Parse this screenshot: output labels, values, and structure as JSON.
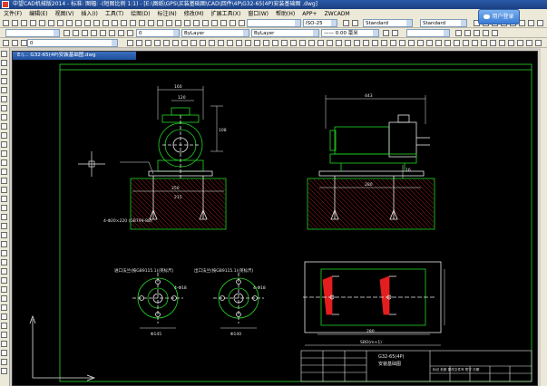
{
  "app": {
    "title": "中望CAD机械版2014 - 标准: 图幅: -(短图比例 1:1) - [E:\\图纸\\GPS\\买装基础图\\CAD\\回件\\4P\\G32-65(4P)安装基础图 .dwg]",
    "login_label": "用户登录"
  },
  "menu": [
    "文件(F)",
    "编辑(E)",
    "视图(V)",
    "插入(I)",
    "工具(T)",
    "绘图(D)",
    "标注(N)",
    "修改(M)",
    "扩展工具(X)",
    "窗口(W)",
    "帮助(H)",
    "APP+",
    "ZWCADM"
  ],
  "toolbar": {
    "text_style": "Standard",
    "dim_style": "Standard",
    "iso": "ISO-25",
    "layer": "0",
    "color": "ByLayer",
    "linetype": "ByLayer",
    "lineweight": "—— 0.00 毫米",
    "plot": "0"
  },
  "drawing": {
    "tab_title": "E:\\… G32-65(4P)安装基础图.dwg",
    "dims": {
      "front_top": "160",
      "front_h1": "120",
      "front_side": "108",
      "base_left": "250",
      "base_w": "215",
      "side_top": "443",
      "side_base": "280",
      "side_h": "16",
      "plan_w": "280",
      "plan_total": "SBO(m+1)"
    },
    "labels": {
      "anchor": "4-Φ20×220\n(GB799-88)",
      "circle_left": "进口法兰(按GB9115.1)(英标尺)",
      "circle_right": "出口法兰(按GB9115.1)(英标尺)",
      "dn_left": "Φ145",
      "dn_right": "Φ140",
      "holes": "4-Φ18"
    },
    "titleblock": {
      "name": "G32-65(4P)",
      "subtitle": "安装基础图",
      "cols": [
        "标记",
        "处数",
        "更改文件号",
        "签字",
        "日期"
      ]
    }
  }
}
